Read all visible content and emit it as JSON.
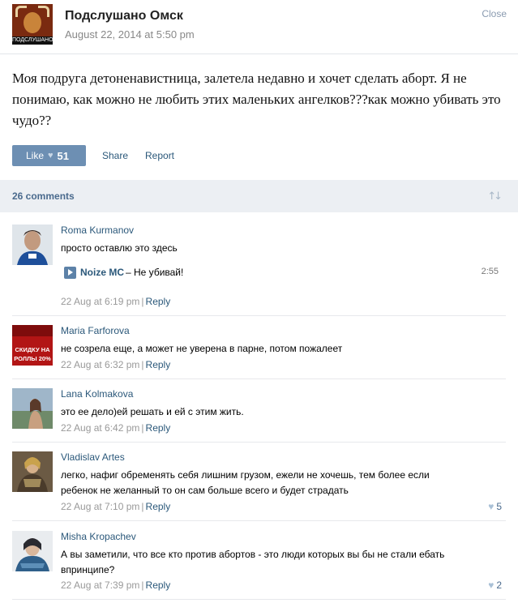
{
  "post": {
    "group_name": "Подслушано Омск",
    "avatar_caption": "ПОДСЛУШАНО",
    "date": "August 22, 2014 at 5:50 pm",
    "close_label": "Close",
    "text": "Моя подруга детоненавистница, залетела недавно и хочет сделать аборт. Я не понимаю, как можно не любить этих маленьких ангелков???как можно убивать это чудо??",
    "like_label": "Like",
    "like_count": "51",
    "share_label": "Share",
    "report_label": "Report"
  },
  "comments_header": {
    "count_label": "26 comments"
  },
  "comments": [
    {
      "author": "Roma Kurmanov",
      "text": "просто оставлю это здесь",
      "audio": {
        "artist": "Noize MC",
        "title": "– Не убивай!",
        "duration": "2:55"
      },
      "time": "22 Aug at 6:19 pm",
      "sep": "|",
      "reply": "Reply"
    },
    {
      "author": "Maria Farforova",
      "text": "не созрела еще, а может не уверена в парне, потом пожалеет",
      "avatar_text": "СКИДКУ НА РОЛЛЫ 20%",
      "time": "22 Aug at 6:32 pm",
      "sep": "|",
      "reply": "Reply"
    },
    {
      "author": "Lana Kolmakova",
      "text": "это ее дело)ей решать и ей с этим жить.",
      "time": "22 Aug at 6:42 pm",
      "sep": "|",
      "reply": "Reply"
    },
    {
      "author": "Vladislav Artes",
      "text": "легко, нафиг обременять себя лишним грузом, ежели не хочешь, тем более если ребенок не желанный то он сам больше всего и будет страдать",
      "time": "22 Aug at 7:10 pm",
      "sep": "|",
      "reply": "Reply",
      "likes": "5"
    },
    {
      "author": "Misha Kropachev",
      "text": "А вы заметили, что все кто против абортов - это люди которых вы бы не стали ебать впринципе?",
      "time": "22 Aug at 7:39 pm",
      "sep": "|",
      "reply": "Reply",
      "likes": "2"
    }
  ],
  "icons": {
    "heart": "heart-icon",
    "sort": "sort-icon",
    "play": "play-icon"
  },
  "colors": {
    "link": "#2b587a",
    "like_button": "#6d8fb3",
    "comments_bar": "#eceff3"
  }
}
